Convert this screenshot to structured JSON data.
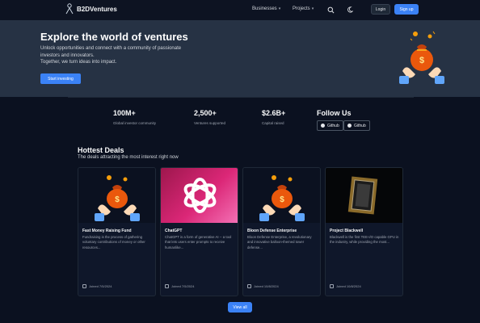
{
  "nav": {
    "brand": "B2DVentures",
    "links": [
      {
        "label": "Businesses",
        "icon": "chevron-down-icon"
      },
      {
        "label": "Projects",
        "icon": "chevron-down-icon"
      }
    ],
    "search_icon": "search-icon",
    "theme_icon": "moon-icon",
    "login_label": "Login",
    "signup_label": "Sign up"
  },
  "hero": {
    "title": "Explore the world of ventures",
    "subtitle_line1": "Unlock opportunities and connect with a community of passionate",
    "subtitle_line2": "investors and innovators.",
    "subtitle_line3": "Together, we turn ideas into impact.",
    "cta_label": "Start investing"
  },
  "stats": [
    {
      "value": "100M+",
      "label": "Global investor community"
    },
    {
      "value": "2,500+",
      "label": "Ventures supported"
    },
    {
      "value": "$2.6B+",
      "label": "Capital raised"
    }
  ],
  "follow": {
    "title": "Follow Us",
    "buttons": [
      "Github",
      "Github"
    ]
  },
  "deals": {
    "title": "Hottest Deals",
    "subtitle": "The deals attracting the most interest right now",
    "cards": [
      {
        "title": "Fast Money Raising Fund",
        "desc": "Fundraising is the process of gathering voluntary contributions of money or other resources...",
        "date": "Joined 7/5/2024"
      },
      {
        "title": "ChatGPT",
        "desc": "ChatGPT is a form of generative AI -- a tool that lets users enter prompts to receive humanlike...",
        "date": "Joined 7/5/2024"
      },
      {
        "title": "Bloon Defense Enterprise",
        "desc": "Bloon Defense Enterprise, a revolutionary and innovative balloon-themed tower defense...",
        "date": "Joined 10/8/2024"
      },
      {
        "title": "Project Blackwell",
        "desc": "Blackwell is the first TEE-I/O capable GPU in the industry, while providing the most...",
        "date": "Joined 10/8/2024"
      }
    ],
    "view_all_label": "View all"
  },
  "colors": {
    "accent": "#3b82f6",
    "background": "#0b1120",
    "hero_bg": "#263244"
  }
}
